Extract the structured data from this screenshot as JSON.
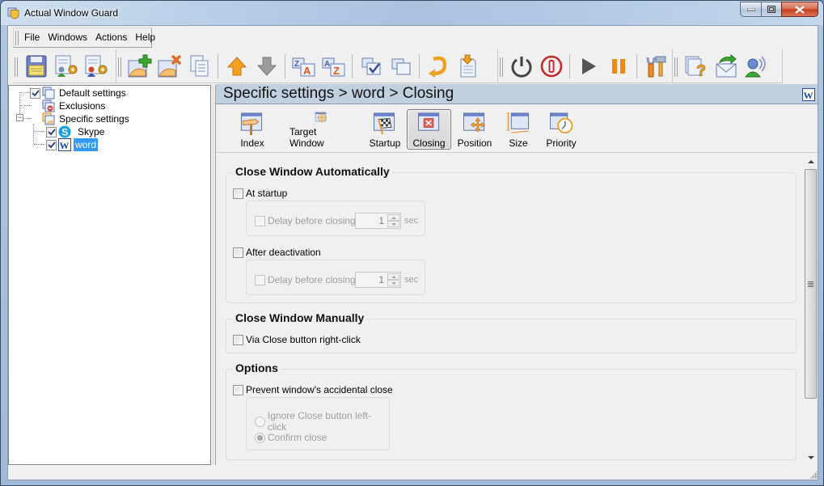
{
  "window": {
    "title": "Actual Window Guard",
    "controls": [
      "minimize",
      "maximize",
      "close"
    ]
  },
  "menubar": {
    "items": [
      "File",
      "Windows",
      "Actions",
      "Help"
    ]
  },
  "toolbar": {
    "buttons": [
      {
        "name": "save",
        "icon": "floppy-disk-icon"
      },
      {
        "name": "user-settings",
        "icon": "user-document-gear-icon"
      },
      {
        "name": "other-user-settings",
        "icon": "user-red-document-gear-icon"
      },
      {
        "name": "add-window-settings",
        "icon": "folder-add-icon"
      },
      {
        "name": "delete-window-settings",
        "icon": "folder-delete-icon"
      },
      {
        "name": "copy-settings",
        "icon": "copy-documents-icon"
      },
      {
        "name": "move-up",
        "icon": "arrow-up-icon"
      },
      {
        "name": "move-down",
        "icon": "arrow-down-icon"
      },
      {
        "name": "sort-z-a",
        "icon": "sort-za-icon"
      },
      {
        "name": "sort-a-z",
        "icon": "sort-az-icon"
      },
      {
        "name": "check-all",
        "icon": "checklist-icon"
      },
      {
        "name": "windows",
        "icon": "windows-stack-icon"
      },
      {
        "name": "reload",
        "icon": "reload-icon"
      },
      {
        "name": "import",
        "icon": "import-document-icon"
      },
      {
        "name": "power",
        "icon": "power-icon"
      },
      {
        "name": "stop",
        "icon": "stop-icon"
      },
      {
        "name": "start",
        "icon": "play-icon"
      },
      {
        "name": "pause",
        "icon": "pause-icon"
      },
      {
        "name": "options",
        "icon": "tools-icon"
      },
      {
        "name": "help",
        "icon": "help-icon"
      },
      {
        "name": "feedback",
        "icon": "mail-icon"
      },
      {
        "name": "support",
        "icon": "user-support-icon"
      }
    ]
  },
  "tree": {
    "items": [
      {
        "label": "Default settings",
        "checked": true,
        "icon": "windows-icon",
        "level": 0
      },
      {
        "label": "Exclusions",
        "checked": null,
        "icon": "exclusions-icon",
        "level": 0
      },
      {
        "label": "Specific settings",
        "checked": null,
        "icon": "folder-windows-icon",
        "level": 0,
        "expanded": true
      },
      {
        "label": "Skype",
        "checked": true,
        "icon": "skype-icon",
        "level": 1
      },
      {
        "label": "word",
        "checked": true,
        "icon": "word-icon",
        "level": 1,
        "selected": true
      }
    ]
  },
  "breadcrumb": {
    "text": "Specific settings > word > Closing",
    "icon": "word-icon"
  },
  "tabs": [
    {
      "label": "Index",
      "icon": "signpost-icon",
      "active": false
    },
    {
      "label": "Target Window",
      "icon": "target-icon",
      "active": false
    },
    {
      "label": "Startup",
      "icon": "checkered-flag-icon",
      "active": false
    },
    {
      "label": "Closing",
      "icon": "close-window-icon",
      "active": true
    },
    {
      "label": "Position",
      "icon": "move-arrows-icon",
      "active": false
    },
    {
      "label": "Size",
      "icon": "resize-icon",
      "active": false
    },
    {
      "label": "Priority",
      "icon": "clock-icon",
      "active": false
    }
  ],
  "close_auto": {
    "title": "Close Window Automatically",
    "at_startup": {
      "label": "At startup",
      "checked": false
    },
    "startup_delay": {
      "label": "Delay before closing",
      "checked": false,
      "value": "1",
      "unit": "sec"
    },
    "after_deactivation": {
      "label": "After deactivation",
      "checked": false
    },
    "deactivation_delay": {
      "label": "Delay before closing",
      "checked": false,
      "value": "1",
      "unit": "sec"
    }
  },
  "close_manual": {
    "title": "Close Window Manually",
    "via_right_click": {
      "label": "Via Close button right-click",
      "checked": false
    }
  },
  "options": {
    "title": "Options",
    "prevent_close": {
      "label": "Prevent window's accidental close",
      "checked": false
    },
    "ignore_left_click": {
      "label": "Ignore Close button left-click",
      "selected": false
    },
    "confirm_close": {
      "label": "Confirm close",
      "selected": true
    }
  },
  "colors": {
    "selection": "#3399ff",
    "breadcrumb_bg": "#c1d0de",
    "close_button": "#c4391d"
  }
}
